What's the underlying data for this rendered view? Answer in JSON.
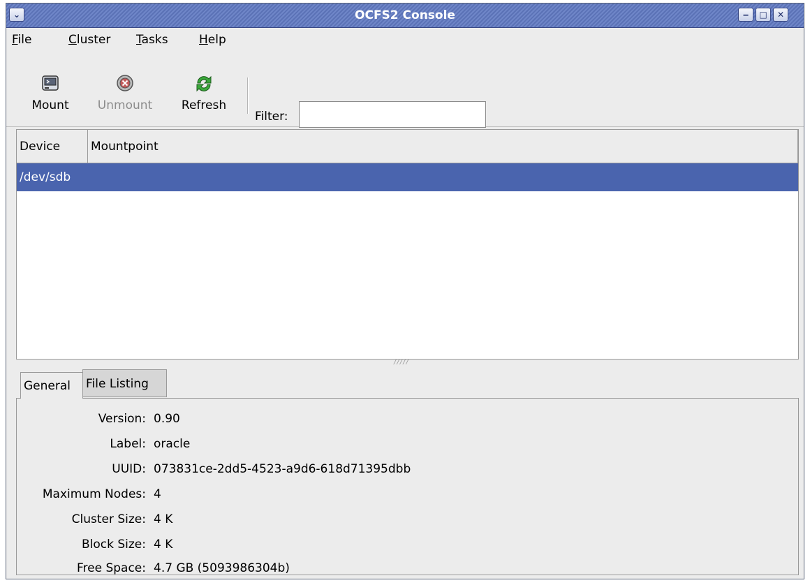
{
  "window": {
    "title": "OCFS2 Console"
  },
  "menu": [
    {
      "key": "F",
      "rest": "ile"
    },
    {
      "key": "C",
      "rest": "luster"
    },
    {
      "key": "T",
      "rest": "asks"
    },
    {
      "key": "H",
      "rest": "elp"
    }
  ],
  "toolbar": {
    "mount_label": "Mount",
    "unmount_label": "Unmount",
    "refresh_label": "Refresh",
    "filter_label": "Filter:",
    "filter_value": ""
  },
  "device_list": {
    "columns": [
      "Device",
      "Mountpoint"
    ],
    "rows": [
      {
        "device": "/dev/sdb",
        "mountpoint": "",
        "selected": true
      }
    ]
  },
  "tabs": [
    "General",
    "File Listing"
  ],
  "active_tab": "General",
  "details": [
    {
      "label": "Version:",
      "value": "0.90"
    },
    {
      "label": "Label:",
      "value": "oracle"
    },
    {
      "label": "UUID:",
      "value": "073831ce-2dd5-4523-a9d6-618d71395dbb"
    },
    {
      "label": "Maximum Nodes:",
      "value": "4"
    },
    {
      "label": "Cluster Size:",
      "value": "4 K"
    },
    {
      "label": "Block Size:",
      "value": "4 K"
    },
    {
      "label": "Free Space:",
      "value": "4.7 GB (5093986304b)"
    }
  ],
  "colors": {
    "selection": "#4a64ae",
    "titlebar": "#6f86c8"
  }
}
